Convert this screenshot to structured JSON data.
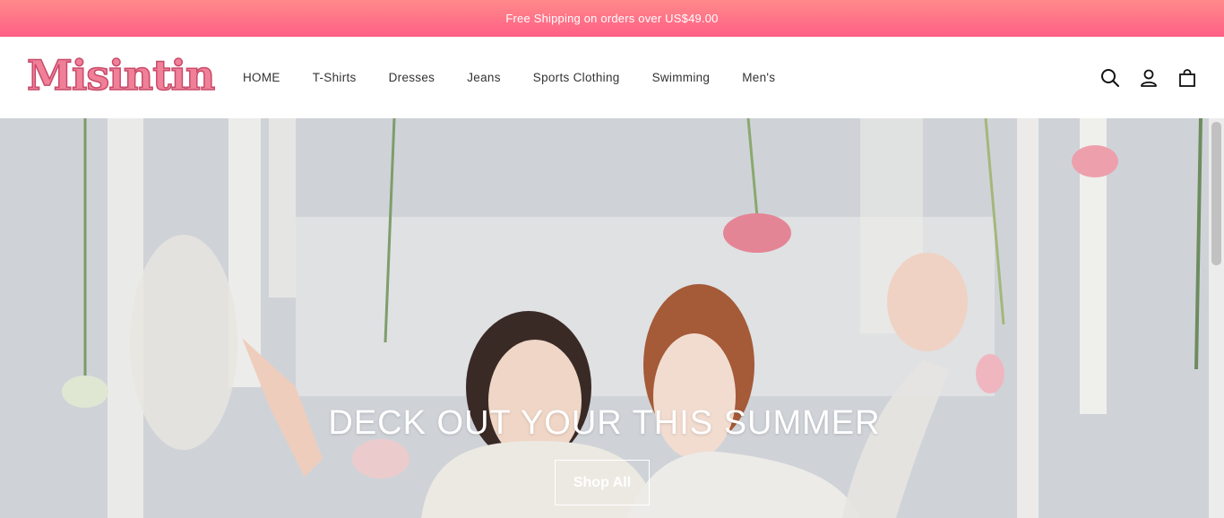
{
  "announcement": {
    "text": "Free Shipping on orders over US$49.00"
  },
  "header": {
    "logo_text": "Misintin",
    "nav": [
      {
        "label": "HOME"
      },
      {
        "label": "T-Shirts"
      },
      {
        "label": "Dresses"
      },
      {
        "label": "Jeans"
      },
      {
        "label": "Sports Clothing"
      },
      {
        "label": "Swimming"
      },
      {
        "label": "Men's"
      }
    ],
    "icons": [
      "search-icon",
      "account-icon",
      "cart-icon"
    ]
  },
  "hero": {
    "title": "DECK OUT YOUR THIS SUMMER",
    "button_label": "Shop All"
  },
  "colors": {
    "announcement_top": "#ff8a8a",
    "announcement_bottom": "#ff5f86",
    "logo_fill": "#f08098",
    "logo_stroke": "#c84a6a"
  }
}
